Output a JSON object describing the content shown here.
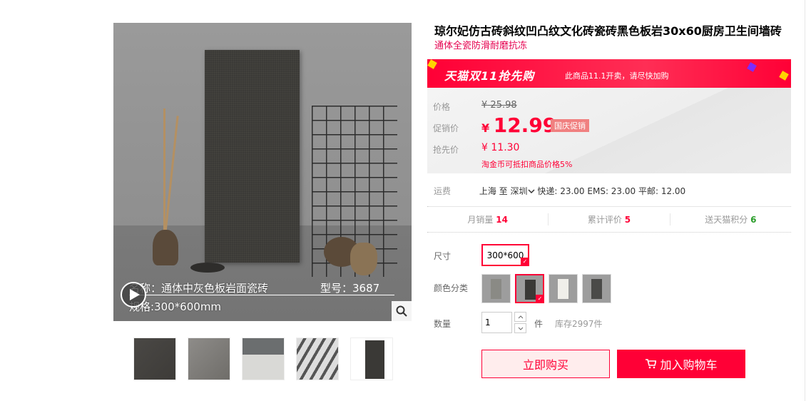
{
  "product": {
    "title": "琼尔妃仿古砖斜纹凹凸纹文化砖瓷砖黑色板岩30x60厨房卫生间墙砖",
    "subtitle": "通体全瓷防滑耐磨抗冻"
  },
  "gallery": {
    "caption_name": "名称：通体中灰色板岩面瓷砖",
    "caption_model": "型号：3687",
    "caption_spec": "规格:300*600mm",
    "thumbnail_count": 5
  },
  "promo": {
    "logo": "天猫双11抢先购",
    "note": "此商品11.1开卖，请尽快加购"
  },
  "price": {
    "label": "价格",
    "currency": "¥",
    "original": "25.98",
    "sale_label": "促销价",
    "sale": "12.99",
    "tag": "国庆促销",
    "rush_label": "抢先价",
    "rush": "11.30",
    "coin_note": "淘金币可抵扣商品价格5%"
  },
  "shipping": {
    "label": "运费",
    "origin": "上海",
    "to": "至",
    "destination": "深圳",
    "rates": "快递: 23.00 EMS: 23.00 平邮: 12.00"
  },
  "stats": {
    "monthly_sales_label": "月销量",
    "monthly_sales": "14",
    "reviews_label": "累计评价",
    "reviews": "5",
    "points_label": "送天猫积分",
    "points": "6"
  },
  "options": {
    "size_label": "尺寸",
    "size_value": "300*600",
    "color_label": "颜色分类",
    "color_count": 4,
    "color_selected_index": 1,
    "qty_label": "数量",
    "qty_value": "1",
    "qty_unit": "件",
    "stock": "库存2997件"
  },
  "actions": {
    "buy_now": "立即购买",
    "add_cart": "加入购物车"
  },
  "colors": {
    "accent": "#ff0036",
    "sub_text": "#e5004f"
  }
}
